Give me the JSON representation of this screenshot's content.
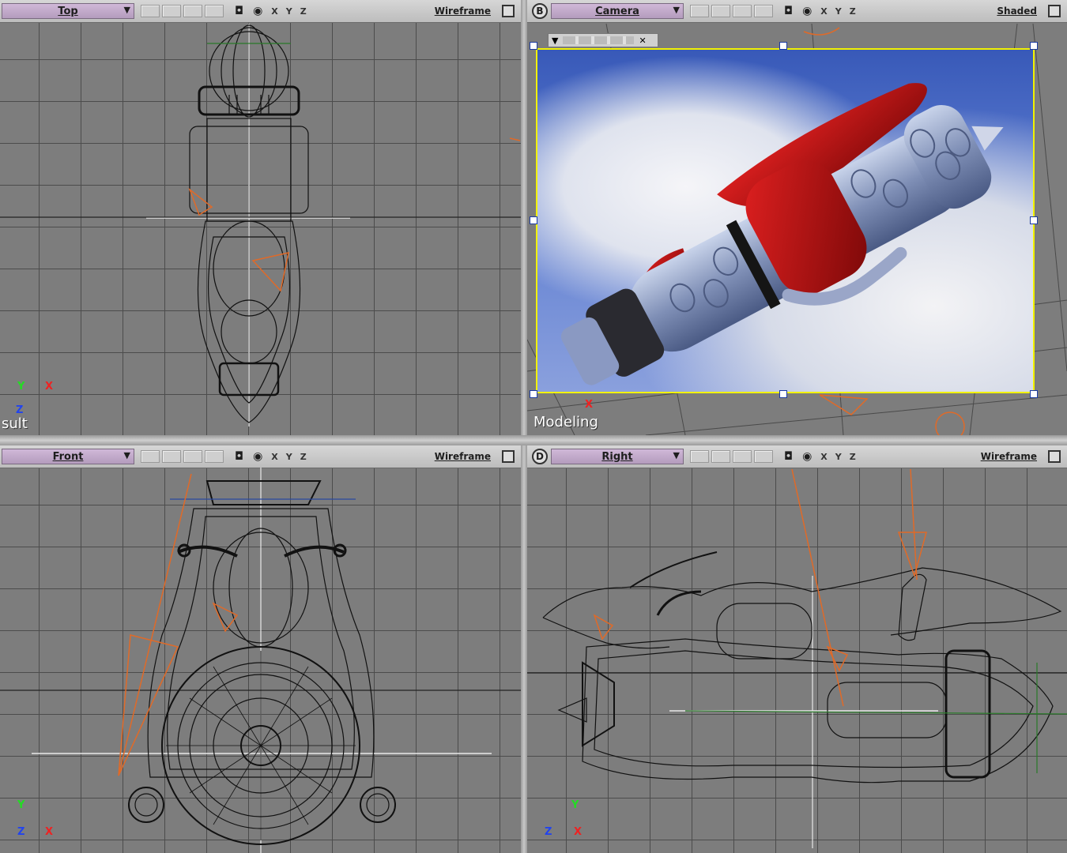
{
  "viewports": {
    "top": {
      "view": "Top",
      "mode": "Wireframe",
      "axes": [
        "X",
        "Y",
        "Z"
      ],
      "corner_text": "sult",
      "triad": {
        "a": "Y",
        "b": "X",
        "c": "Z"
      }
    },
    "camera": {
      "letter": "B",
      "view": "Camera",
      "mode": "Shaded",
      "axes": [
        "X",
        "Y",
        "Z"
      ],
      "overlay_text": "Modeling",
      "triad": {
        "b": "X"
      }
    },
    "front": {
      "view": "Front",
      "mode": "Wireframe",
      "axes": [
        "X",
        "Y",
        "Z"
      ],
      "triad": {
        "a": "Y",
        "b": "X",
        "c": "Z"
      }
    },
    "right": {
      "letter": "D",
      "view": "Right",
      "mode": "Wireframe",
      "axes": [
        "X",
        "Y",
        "Z"
      ],
      "triad": {
        "a": "Y",
        "b": "X",
        "c": "Z"
      }
    }
  },
  "icons": {
    "camera": "camera-icon",
    "eye": "eye-icon",
    "dropdown": "dropdown-arrow-icon",
    "maximize": "maximize-icon"
  },
  "colors": {
    "wire": "#111111",
    "light": "#e06a28",
    "selection": "#f2f200"
  }
}
